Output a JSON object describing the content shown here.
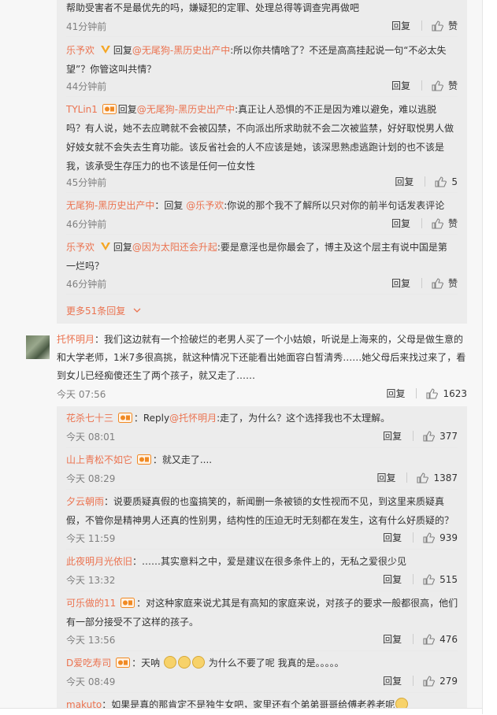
{
  "top_thread": {
    "lead_text": "帮助受害者不是最优先的吗，嫌疑犯的定罪、处理总得等调查完再做吧",
    "lead_time": "41分钟前",
    "replies": [
      {
        "user": "乐予欢",
        "reply_word": "回复",
        "target": "@无尾狗-黑历史出产中",
        "text_line1": ":所以你共情啥了？不还是高高挂起说一句“不必太失",
        "text_line2": "望”？你管这叫共情？",
        "time": "44分钟前",
        "likes": "赞"
      },
      {
        "user": "TYLin1",
        "reply_word": "回复",
        "target": "@无尾狗-黑历史出产中",
        "text_line1": ":真正让人恐惧的不正是因为难以避免，难以逃脱",
        "text_line2": "吗？有人说，她不去应聘就不会被囚禁，不向派出所求助就不会二次被监禁，好好取悦男人做",
        "text_line3": "好妓女就不会失去生育功能。该反省社会的人不应该是她，该深思熟虑逃跑计划的也不该是",
        "text_line4": "我，该承受生存压力的也不该是任何一位女性",
        "time": "45分钟前",
        "likes": "5"
      },
      {
        "user": "无尾狗-黑历史出产中",
        "reply_word": "：回复",
        "target": "@乐予欢",
        "text_line1": ":你说的那个我不了解所以只对你的前半句话发表评论",
        "time": "46分钟前",
        "likes": "赞"
      },
      {
        "user": "乐予欢",
        "reply_word": "回复",
        "target": "@因为太阳还会升起",
        "text_line1": ":要是意淫也是你最会了，博主及这个层主有说中国是第",
        "text_line2": "一烂吗？",
        "time": "46分钟前",
        "likes": "赞"
      }
    ],
    "more_replies": "更多51条回复"
  },
  "action_reply": "回复",
  "main_comment": {
    "user": "托怀明月",
    "text_line1": "：我们这边就有一个捡破烂的老男人买了一个小姑娘，听说是上海来的，父母是做生意的",
    "text_line2": "和大学老师，1米7多很高挑，就这种情况下还能看出她面容白皙清秀……她父母后来找过来了，看",
    "text_line3": "到女儿已经痴傻还生了两个孩子，就又走了……",
    "time": "今天 07:56",
    "likes": "1623"
  },
  "sub_replies": [
    {
      "user": "花杀七十三",
      "text": "：Reply",
      "target": "@托怀明月",
      "text2": ":走了，为什么？这个选择我也不太理解。",
      "time": "今天 08:01",
      "likes": "377"
    },
    {
      "user": "山上青松不如它",
      "text": "：就又走了....",
      "time": "今天 08:29",
      "likes": "1387"
    },
    {
      "user": "夕云朝雨",
      "text": "：说要质疑真假的也蛮搞笑的，新闻删一条被锁的女性视而不见，到这里来质疑真",
      "text_b": "假，不管你是精神男人还真的性别男，结构性的压迫无时无刻都在发生，这有什么好质疑的？",
      "time": "今天 11:59",
      "likes": "939"
    },
    {
      "user": "此夜明月光依旧",
      "text": "：……其实意料之中，爱是建议在很多条件上的，无私之爱很少见",
      "time": "今天 13:32",
      "likes": "515"
    },
    {
      "user": "可乐做的11",
      "text": "：对这种家庭来说尤其是有高知的家庭来说，对孩子的要求一般都很高，他们",
      "text_b": "有一部分接受不了这样的孩子。",
      "time": "今天 13:56",
      "likes": "476"
    },
    {
      "user": "D爱吃寿司",
      "text": "：天呐",
      "text_after": "为什么不要了呢 我真的是。。。。。",
      "time": "今天 08:49",
      "likes": "279"
    },
    {
      "user": "makuto",
      "text": "：如果是真的那肯定不是独生女吧，家里还有个弟弟哥哥给傅老养老呢"
    }
  ],
  "colors": {
    "link": "#eb7350",
    "meta": "#808080",
    "text": "#333333",
    "bg": "#f7f7f7",
    "subbg": "#ececec"
  }
}
